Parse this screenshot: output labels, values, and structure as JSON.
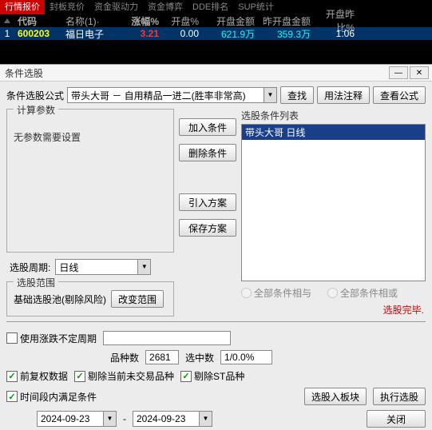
{
  "topTabs": [
    "行情报价",
    "封板竞价",
    "资金驱动力",
    "资金博弈",
    "DDE排名",
    "SUP统计"
  ],
  "activeTab": 0,
  "grid": {
    "headers": [
      "",
      "代码",
      "名称(1)·",
      "涨幅%",
      "开盘%",
      "开盘金额",
      "昨开盘金额",
      "开盘昨比%"
    ],
    "row": {
      "idx": "1",
      "code": "600203",
      "name": "福日电子",
      "pct": "3.21",
      "open": "0.00",
      "amt1": "621.9万",
      "amt2": "359.3万",
      "rate": "1.06"
    }
  },
  "dlg": {
    "title": "条件选股",
    "formulaLabel": "条件选股公式",
    "formulaText": "带头大哥 － 自用精品一进二(胜率非常高)",
    "btnFind": "查找",
    "btnUsage": "用法注释",
    "btnView": "查看公式",
    "legends": {
      "calc": "计算参数",
      "scope": "选股范围",
      "list": "选股条件列表"
    },
    "noParam": "无参数需要设置",
    "periodLbl": "选股周期:",
    "periodVal": "日线",
    "scopeDefault": "基础选股池(剔除风险)",
    "btnScope": "改变范围",
    "midBtns": {
      "add": "加入条件",
      "del": "删除条件",
      "import": "引入方案",
      "save": "保存方案"
    },
    "condItem": "带头大哥  日线",
    "radioAnd": "全部条件相与",
    "radioOr": "全部条件相或",
    "done": "选股完毕.",
    "useUndef": "使用涨跌不定周期",
    "kindLbl": "品种数",
    "kindVal": "2681",
    "hitLbl": "选中数",
    "hitVal": "1/0.0%",
    "cbQfq": "前复权数据",
    "cbExclNoTrade": "剔除当前未交易品种",
    "cbExclST": "剔除ST品种",
    "cbTimeRange": "时间段内满足条件",
    "btnToBlock": "选股入板块",
    "btnExec": "执行选股",
    "dateFrom": "2024-09-23",
    "dateTo": "2024-09-23",
    "btnClose": "关闭"
  }
}
